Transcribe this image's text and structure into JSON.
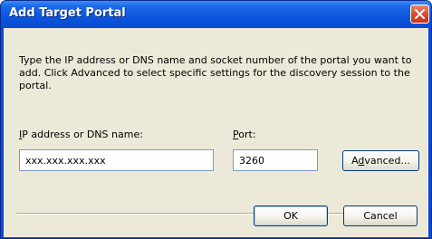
{
  "dialog": {
    "title": "Add Target Portal",
    "description": "Type the IP address or DNS name and socket number of the portal you want to add. Click Advanced to select specific settings for the discovery session to the portal.",
    "ip_label_mnemonic": "I",
    "ip_label_rest": "P address or DNS name:",
    "ip_value": "xxx.xxx.xxx.xxx",
    "port_label_mnemonic": "P",
    "port_label_rest": "ort:",
    "port_value": "3260",
    "advanced_button_pre": "A",
    "advanced_button_mnemonic": "d",
    "advanced_button_post": "vanced...",
    "ok_label": "OK",
    "cancel_label": "Cancel"
  },
  "icons": {
    "close": "close-x-icon"
  },
  "colors": {
    "titlebar": "#0b55dc",
    "client": "#ece9d8",
    "close_button": "#d8472a",
    "input_border": "#7f9db9"
  }
}
